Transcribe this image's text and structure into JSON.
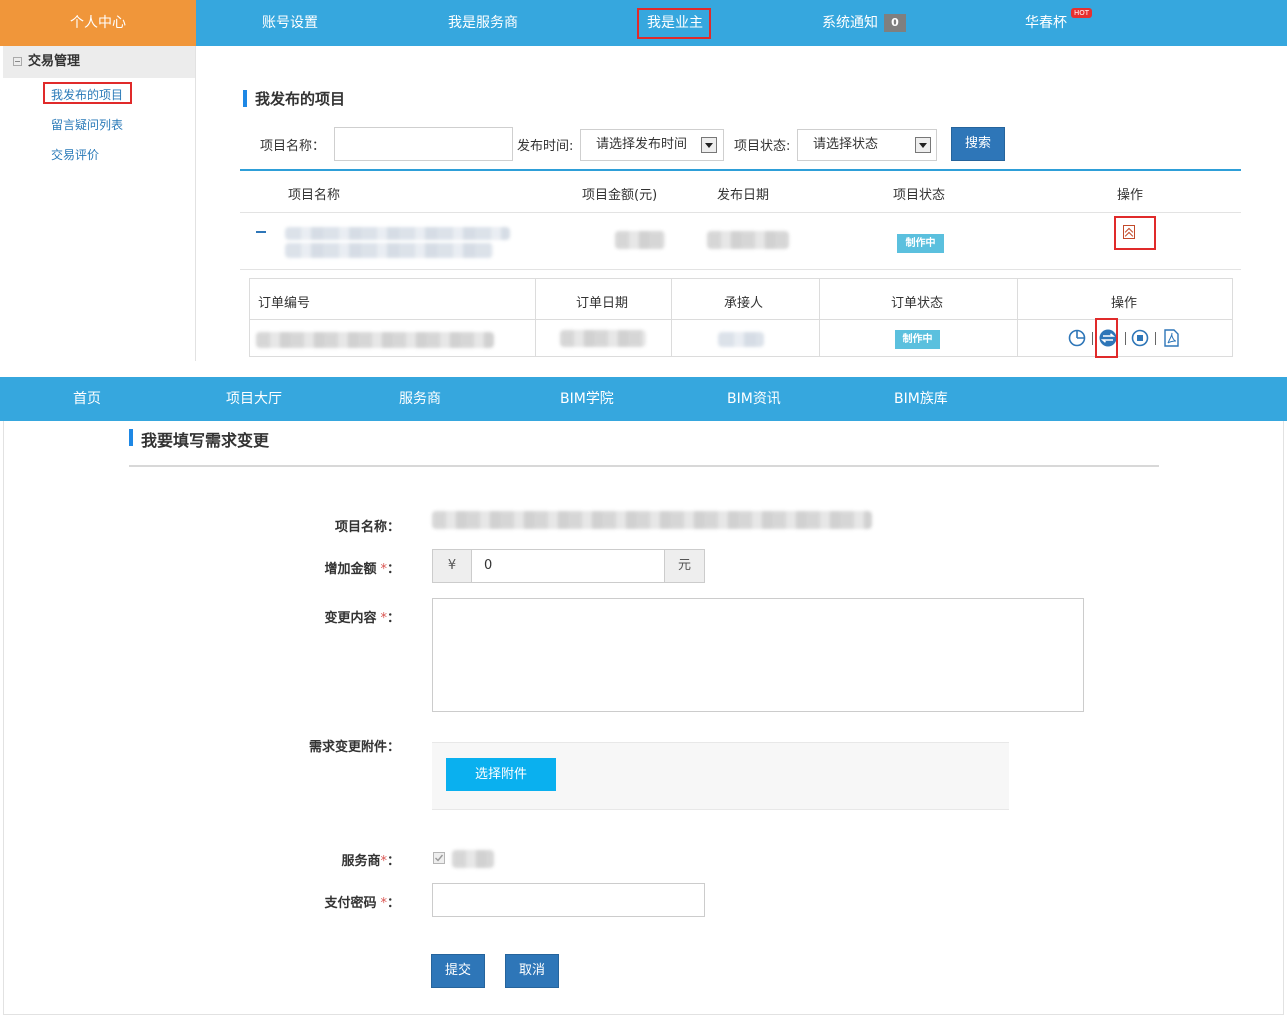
{
  "top_nav": {
    "home": "个人中心",
    "items": [
      "账号设置",
      "我是服务商",
      "我是业主",
      "系统通知",
      "华春杯"
    ],
    "notify_count": "0",
    "hot_badge": "HOT"
  },
  "sidebar": {
    "group": "交易管理",
    "items": [
      "我发布的项目",
      "留言疑问列表",
      "交易评价"
    ]
  },
  "projects": {
    "title": "我发布的项目",
    "search": {
      "name_label": "项目名称：",
      "name_value": "",
      "time_label": "发布时间:",
      "time_placeholder": "请选择发布时间",
      "status_label": "项目状态:",
      "status_placeholder": "请选择状态",
      "button": "搜索"
    },
    "columns": [
      "项目名称",
      "项目金额(元)",
      "发布日期",
      "项目状态",
      "操作"
    ],
    "row_status": "制作中"
  },
  "orders": {
    "columns": [
      "订单编号",
      "订单日期",
      "承接人",
      "订单状态",
      "操作"
    ],
    "row_status": "制作中",
    "op_icons": [
      "pie-chart-icon",
      "change-request-icon",
      "stop-icon",
      "pdf-icon"
    ]
  },
  "bottom_nav": {
    "items": [
      "首页",
      "项目大厅",
      "服务商",
      "BIM学院",
      "BIM资讯",
      "BIM族库"
    ]
  },
  "change_form": {
    "title": "我要填写需求变更",
    "name_label": "项目名称：",
    "amount_label": "增加金额",
    "amount_prefix": "¥",
    "amount_value": "0",
    "amount_suffix": "元",
    "content_label": "变更内容",
    "attach_label": "需求变更附件：",
    "attach_button": "选择附件",
    "provider_label": "服务商",
    "password_label": "支付密码",
    "required_mark": "*",
    "colon": "：",
    "submit": "提交",
    "cancel": "取消"
  }
}
